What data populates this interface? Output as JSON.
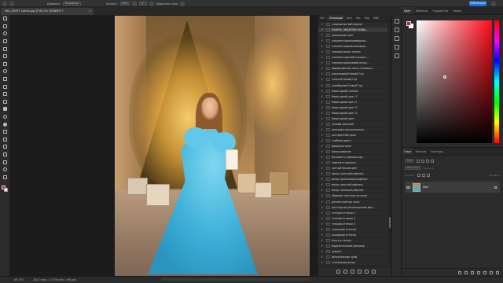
{
  "options_bar": {
    "size_label": "Диаметр:",
    "mode_select": "Подсветка",
    "exposure_label": "Экспоз.:",
    "exposure_value": "20%",
    "angle_value": "0°",
    "protect_tones": "Защитить тона",
    "publish_label": "Публикация"
  },
  "document": {
    "tab_title": "IMG_00347 копия.jpg @ 69,2% (RGB/8*) *",
    "close_glyph": "×"
  },
  "operations_panel": {
    "tabs": [
      "Ист",
      "Операции",
      "Бин",
      "Свс",
      "Кор",
      "Ббб"
    ],
    "active_tab": "Операции",
    "items": [
      "сохранение веб версии",
      "ПАНЕЛЬ ЭКШЕНОВ НОВЫ...",
      "оранжевый свет",
      "спасаем кирпичноморкоо...",
      "спасаем переэкспониров...",
      "спасаем рокот сноунн",
      "спасаем красный колорит...",
      "спасаем оранжевый искру...",
      "выравнивание свето-теневого...",
      "шоколадный Новый Год",
      "золотой Новый Год",
      "серебряный Новый Год",
      "Новогодний снежок",
      "Новогодний цвет 1",
      "Новогодний цвет 2",
      "Новогодний цвет 3",
      "Новогодний цвет 4",
      "Новогодний цвет",
      "сочный красный",
      "красивая насыщенность",
      "контрастные края",
      "глубина цвета",
      "микроконтраст",
      "фильтрование",
      "матовость (имкаша эф...",
      "заватина подлоня",
      "чистый белый цвет",
      "минус красный рефлекс",
      "минус оранжевый рефлекс",
      "минус желтый рефлекс",
      "минус зелёный рефлекс",
      "убираем текстуру на коже",
      "делаем мягкую кожу",
      "растянутое расположение бел...",
      "теплый оттенок 1",
      "теплый оттенок 2",
      "теплый оттенок 3",
      "снижение оттенка",
      "холодный оттенок",
      "блеск в глазах",
      "выразительные ресницы",
      "румяна",
      "белоснежные зубы",
      "стилизация волос",
      "убираем переходы",
      "убираем жесткие тени"
    ]
  },
  "color_panel": {
    "tabs": [
      "Цвет",
      "Образцы",
      "Градиенты",
      "Узоры"
    ],
    "active_tab": "Цвет",
    "foreground_color": "#b8283a",
    "background_color": "#ffffff"
  },
  "layers_panel": {
    "tabs": [
      "Слои",
      "Каналы",
      "Контуры"
    ],
    "active_tab": "Слои",
    "kind_select": "Вид",
    "blend_select": "Обычные",
    "opacity_label": "Непрозр.:",
    "lock_label": "Закреп.:",
    "fill_label": "Заливка:",
    "layer_name": "Фон"
  },
  "status_bar": {
    "zoom": "69,15%",
    "doc_size": "1824 пикс. x 2736 пикс. (96 ppi)"
  }
}
